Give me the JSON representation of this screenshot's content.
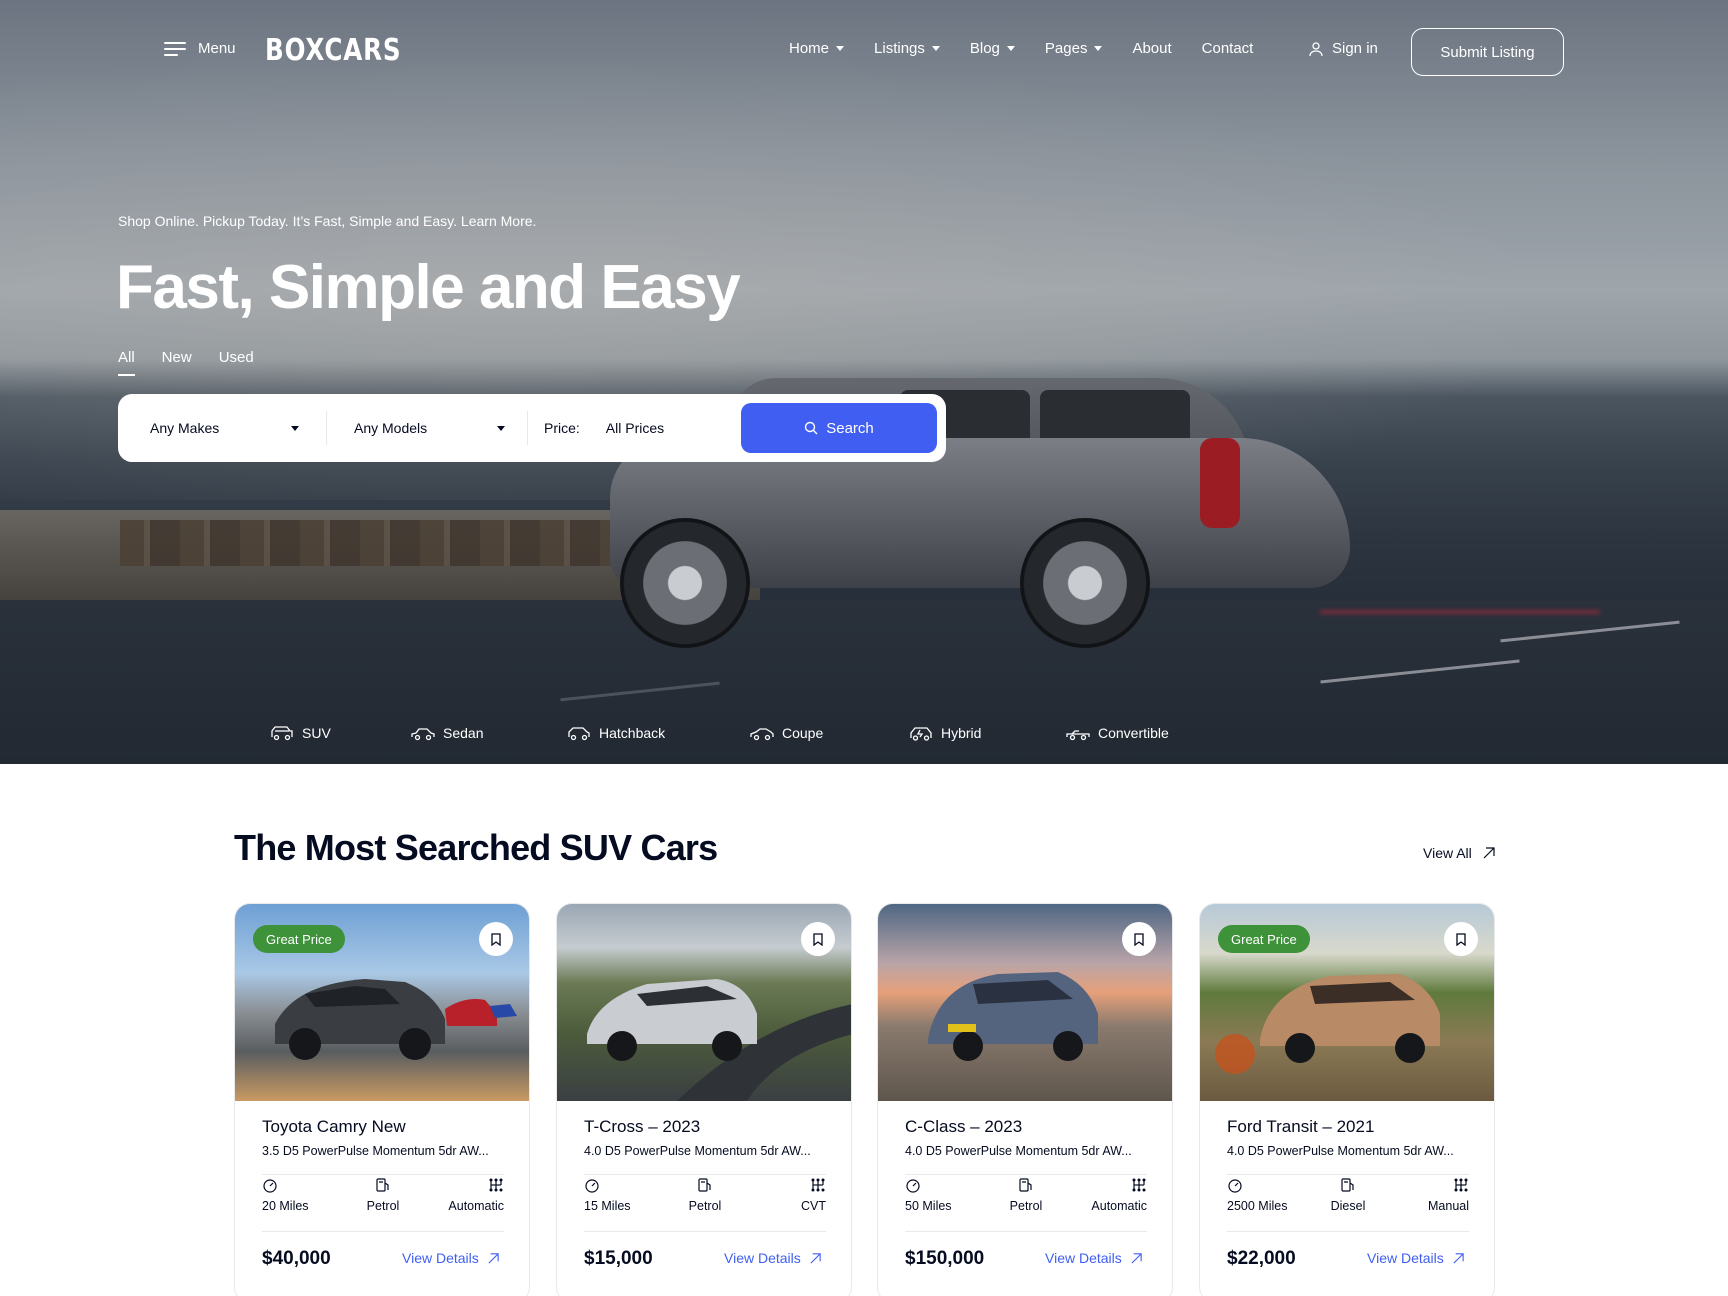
{
  "header": {
    "menu_label": "Menu",
    "logo": "BOXCARS",
    "nav": [
      {
        "label": "Home"
      },
      {
        "label": "Listings"
      },
      {
        "label": "Blog"
      },
      {
        "label": "Pages"
      },
      {
        "label": "About"
      },
      {
        "label": "Contact"
      }
    ],
    "signin_label": "Sign in",
    "submit_label": "Submit Listing"
  },
  "hero": {
    "subtitle": "Shop Online. Pickup Today. It’s Fast, Simple and Easy.  Learn More.",
    "title": "Fast, Simple and Easy",
    "tabs": [
      {
        "label": "All",
        "active": true
      },
      {
        "label": "New",
        "active": false
      },
      {
        "label": "Used",
        "active": false
      }
    ],
    "search": {
      "makes": "Any Makes",
      "models": "Any Models",
      "price_label": "Price:",
      "price_value": "All Prices",
      "button": "Search"
    },
    "categories": [
      {
        "label": "SUV",
        "icon": "suv-icon"
      },
      {
        "label": "Sedan",
        "icon": "sedan-icon"
      },
      {
        "label": "Hatchback",
        "icon": "hatchback-icon"
      },
      {
        "label": "Coupe",
        "icon": "coupe-icon"
      },
      {
        "label": "Hybrid",
        "icon": "hybrid-icon"
      },
      {
        "label": "Convertible",
        "icon": "convertible-icon"
      }
    ]
  },
  "section": {
    "title": "The Most Searched SUV Cars",
    "view_all": "View All"
  },
  "cards": [
    {
      "badge": "Great Price",
      "title": "Toyota Camry New",
      "subtitle": "3.5 D5 PowerPulse Momentum 5dr AW...",
      "miles": "20 Miles",
      "fuel": "Petrol",
      "trans": "Automatic",
      "price": "$40,000",
      "details": "View Details"
    },
    {
      "badge": "",
      "title": "T-Cross – 2023",
      "subtitle": "4.0 D5 PowerPulse Momentum 5dr AW...",
      "miles": "15 Miles",
      "fuel": "Petrol",
      "trans": "CVT",
      "price": "$15,000",
      "details": "View Details"
    },
    {
      "badge": "",
      "title": "C-Class – 2023",
      "subtitle": "4.0 D5 PowerPulse Momentum 5dr AW...",
      "miles": "50 Miles",
      "fuel": "Petrol",
      "trans": "Automatic",
      "price": "$150,000",
      "details": "View Details"
    },
    {
      "badge": "Great Price",
      "title": "Ford Transit – 2021",
      "subtitle": "4.0 D5 PowerPulse Momentum 5dr AW...",
      "miles": "2500 Miles",
      "fuel": "Diesel",
      "trans": "Manual",
      "price": "$22,000",
      "details": "View Details"
    }
  ],
  "colors": {
    "accent": "#405ff2",
    "badge": "#3d923a",
    "text": "#050b20"
  }
}
